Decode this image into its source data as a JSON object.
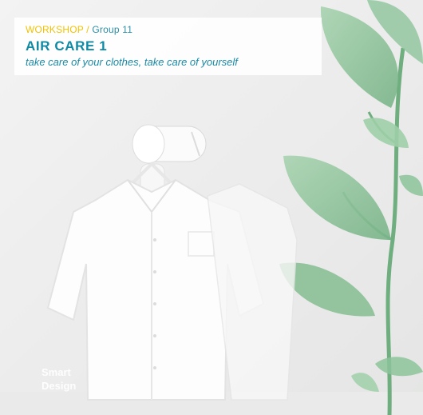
{
  "banner": {
    "workshop": "WORKSHOP",
    "separator": "/",
    "group": "Group 11",
    "title": "AIR CARE 1",
    "subtitle": "take care of your clothes, take care of yourself"
  },
  "logo": {
    "line1": "Smart",
    "line2": "Design"
  },
  "colors": {
    "accent_yellow": "#f2c200",
    "accent_teal": "#0f8aa5",
    "leaf_green": "#8fc49d"
  }
}
